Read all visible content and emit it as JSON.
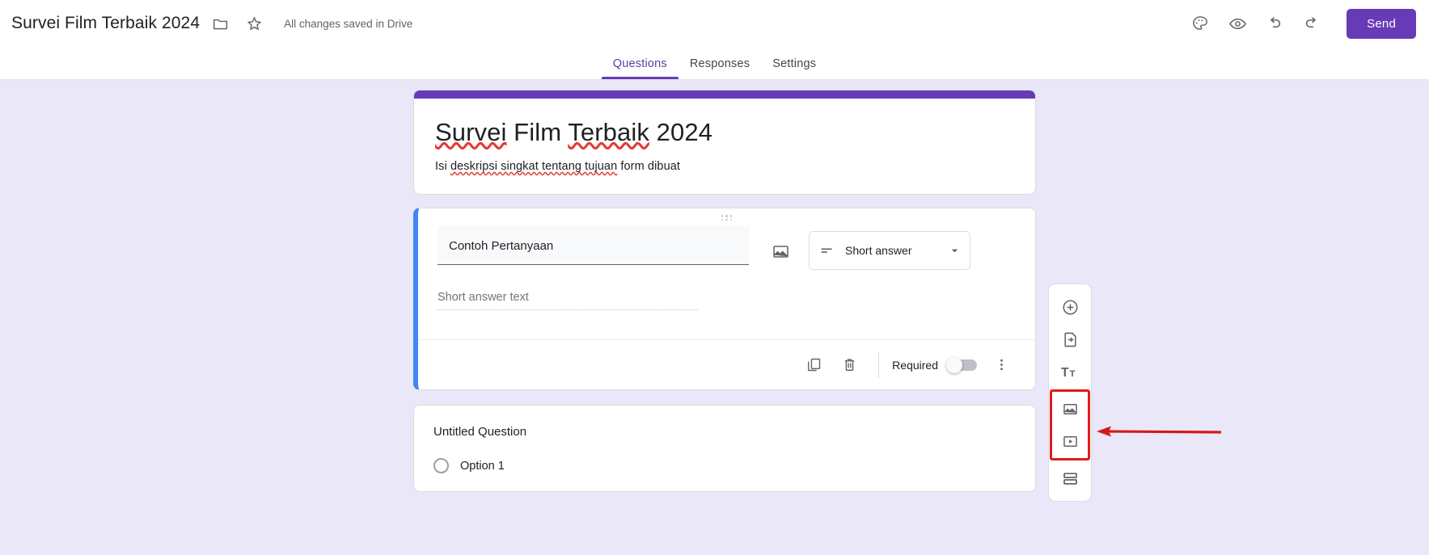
{
  "topbar": {
    "doc_title": "Survei Film Terbaik 2024",
    "folder_icon": "folder-icon",
    "star_icon": "star-icon",
    "save_status": "All changes saved in Drive",
    "theme_icon": "palette-icon",
    "preview_icon": "eye-icon",
    "undo_icon": "undo-icon",
    "redo_icon": "redo-icon",
    "send_label": "Send"
  },
  "tabs": [
    {
      "label": "Questions",
      "active": true
    },
    {
      "label": "Responses",
      "active": false
    },
    {
      "label": "Settings",
      "active": false
    }
  ],
  "form_header": {
    "accent_color": "#673AB7",
    "title_parts": [
      {
        "text": "Survei",
        "spellcheck": true
      },
      {
        "text": " Film ",
        "spellcheck": false
      },
      {
        "text": "Terbaik",
        "spellcheck": true
      },
      {
        "text": " 2024",
        "spellcheck": false
      }
    ],
    "title_plain": "Survei Film Terbaik 2024",
    "description_parts": [
      {
        "text": "Isi ",
        "spellcheck": false
      },
      {
        "text": "deskripsi singkat tentang tujuan",
        "spellcheck": true
      },
      {
        "text": " form dibuat",
        "spellcheck": false
      }
    ],
    "description_plain": "Isi deskripsi singkat tentang tujuan form dibuat"
  },
  "question_card": {
    "accent_color": "#4285F4",
    "drag_handle": "drag-handle-icon",
    "question_text": "Contoh Pertanyaan",
    "add_image_icon": "image-icon",
    "type_icon": "short-answer-icon",
    "type_value": "Short answer",
    "type_chevron": "chevron-down-icon",
    "answer_placeholder": "Short answer text",
    "footer": {
      "duplicate_icon": "duplicate-icon",
      "delete_icon": "trash-icon",
      "required_label": "Required",
      "required_on": false,
      "more_icon": "more-vertical-icon"
    }
  },
  "question_card_2": {
    "title": "Untitled Question",
    "option_label": "Option 1",
    "option_icon": "radio-unchecked-icon"
  },
  "side_toolbar": {
    "items": [
      {
        "name": "add-question-icon",
        "label": "Add question",
        "highlighted": false
      },
      {
        "name": "import-questions-icon",
        "label": "Import questions",
        "highlighted": false
      },
      {
        "name": "add-title-icon",
        "label": "Add title and description",
        "highlighted": false
      },
      {
        "name": "add-image-icon",
        "label": "Add image",
        "highlighted": true
      },
      {
        "name": "add-video-icon",
        "label": "Add video",
        "highlighted": true
      },
      {
        "name": "add-section-icon",
        "label": "Add section",
        "highlighted": false
      }
    ],
    "highlight_color": "#e01b1b"
  },
  "annotation": {
    "arrow_icon": "red-arrow-left",
    "arrow_color": "#d41919"
  }
}
